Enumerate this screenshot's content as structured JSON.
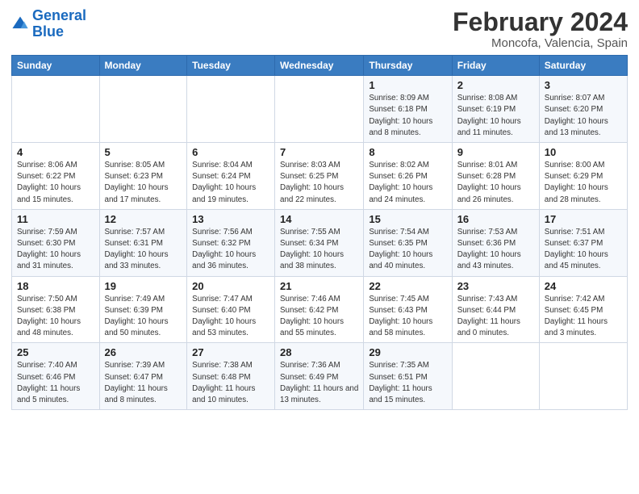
{
  "header": {
    "logo_line1": "General",
    "logo_line2": "Blue",
    "title": "February 2024",
    "subtitle": "Moncofa, Valencia, Spain"
  },
  "days_of_week": [
    "Sunday",
    "Monday",
    "Tuesday",
    "Wednesday",
    "Thursday",
    "Friday",
    "Saturday"
  ],
  "weeks": [
    [
      {
        "day": "",
        "info": ""
      },
      {
        "day": "",
        "info": ""
      },
      {
        "day": "",
        "info": ""
      },
      {
        "day": "",
        "info": ""
      },
      {
        "day": "1",
        "info": "Sunrise: 8:09 AM\nSunset: 6:18 PM\nDaylight: 10 hours and 8 minutes."
      },
      {
        "day": "2",
        "info": "Sunrise: 8:08 AM\nSunset: 6:19 PM\nDaylight: 10 hours and 11 minutes."
      },
      {
        "day": "3",
        "info": "Sunrise: 8:07 AM\nSunset: 6:20 PM\nDaylight: 10 hours and 13 minutes."
      }
    ],
    [
      {
        "day": "4",
        "info": "Sunrise: 8:06 AM\nSunset: 6:22 PM\nDaylight: 10 hours and 15 minutes."
      },
      {
        "day": "5",
        "info": "Sunrise: 8:05 AM\nSunset: 6:23 PM\nDaylight: 10 hours and 17 minutes."
      },
      {
        "day": "6",
        "info": "Sunrise: 8:04 AM\nSunset: 6:24 PM\nDaylight: 10 hours and 19 minutes."
      },
      {
        "day": "7",
        "info": "Sunrise: 8:03 AM\nSunset: 6:25 PM\nDaylight: 10 hours and 22 minutes."
      },
      {
        "day": "8",
        "info": "Sunrise: 8:02 AM\nSunset: 6:26 PM\nDaylight: 10 hours and 24 minutes."
      },
      {
        "day": "9",
        "info": "Sunrise: 8:01 AM\nSunset: 6:28 PM\nDaylight: 10 hours and 26 minutes."
      },
      {
        "day": "10",
        "info": "Sunrise: 8:00 AM\nSunset: 6:29 PM\nDaylight: 10 hours and 28 minutes."
      }
    ],
    [
      {
        "day": "11",
        "info": "Sunrise: 7:59 AM\nSunset: 6:30 PM\nDaylight: 10 hours and 31 minutes."
      },
      {
        "day": "12",
        "info": "Sunrise: 7:57 AM\nSunset: 6:31 PM\nDaylight: 10 hours and 33 minutes."
      },
      {
        "day": "13",
        "info": "Sunrise: 7:56 AM\nSunset: 6:32 PM\nDaylight: 10 hours and 36 minutes."
      },
      {
        "day": "14",
        "info": "Sunrise: 7:55 AM\nSunset: 6:34 PM\nDaylight: 10 hours and 38 minutes."
      },
      {
        "day": "15",
        "info": "Sunrise: 7:54 AM\nSunset: 6:35 PM\nDaylight: 10 hours and 40 minutes."
      },
      {
        "day": "16",
        "info": "Sunrise: 7:53 AM\nSunset: 6:36 PM\nDaylight: 10 hours and 43 minutes."
      },
      {
        "day": "17",
        "info": "Sunrise: 7:51 AM\nSunset: 6:37 PM\nDaylight: 10 hours and 45 minutes."
      }
    ],
    [
      {
        "day": "18",
        "info": "Sunrise: 7:50 AM\nSunset: 6:38 PM\nDaylight: 10 hours and 48 minutes."
      },
      {
        "day": "19",
        "info": "Sunrise: 7:49 AM\nSunset: 6:39 PM\nDaylight: 10 hours and 50 minutes."
      },
      {
        "day": "20",
        "info": "Sunrise: 7:47 AM\nSunset: 6:40 PM\nDaylight: 10 hours and 53 minutes."
      },
      {
        "day": "21",
        "info": "Sunrise: 7:46 AM\nSunset: 6:42 PM\nDaylight: 10 hours and 55 minutes."
      },
      {
        "day": "22",
        "info": "Sunrise: 7:45 AM\nSunset: 6:43 PM\nDaylight: 10 hours and 58 minutes."
      },
      {
        "day": "23",
        "info": "Sunrise: 7:43 AM\nSunset: 6:44 PM\nDaylight: 11 hours and 0 minutes."
      },
      {
        "day": "24",
        "info": "Sunrise: 7:42 AM\nSunset: 6:45 PM\nDaylight: 11 hours and 3 minutes."
      }
    ],
    [
      {
        "day": "25",
        "info": "Sunrise: 7:40 AM\nSunset: 6:46 PM\nDaylight: 11 hours and 5 minutes."
      },
      {
        "day": "26",
        "info": "Sunrise: 7:39 AM\nSunset: 6:47 PM\nDaylight: 11 hours and 8 minutes."
      },
      {
        "day": "27",
        "info": "Sunrise: 7:38 AM\nSunset: 6:48 PM\nDaylight: 11 hours and 10 minutes."
      },
      {
        "day": "28",
        "info": "Sunrise: 7:36 AM\nSunset: 6:49 PM\nDaylight: 11 hours and 13 minutes."
      },
      {
        "day": "29",
        "info": "Sunrise: 7:35 AM\nSunset: 6:51 PM\nDaylight: 11 hours and 15 minutes."
      },
      {
        "day": "",
        "info": ""
      },
      {
        "day": "",
        "info": ""
      }
    ]
  ]
}
